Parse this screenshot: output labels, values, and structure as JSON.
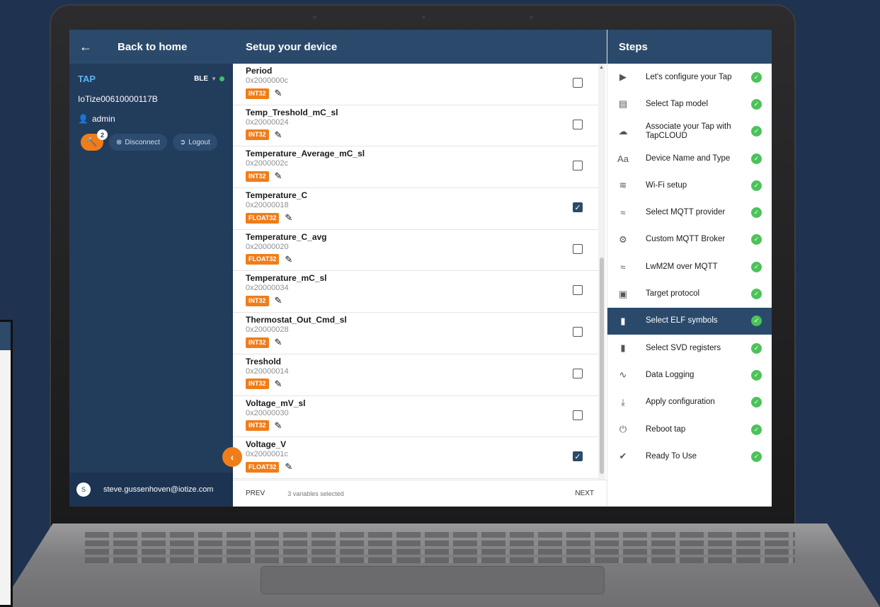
{
  "left": {
    "back_label": "Back to home",
    "tap_name": "TAP",
    "connection": "BLE",
    "device_id": "IoTize00610000117B",
    "user": "admin",
    "tools_badge": "2",
    "disconnect_label": "Disconnect",
    "logout_label": "Logout",
    "avatar_initial": "S",
    "email": "steve.gussenhoven@iotize.com"
  },
  "middle": {
    "title": "Setup your device",
    "prev_label": "PREV",
    "selected_count": "3 variables selected",
    "next_label": "NEXT",
    "variables": [
      {
        "name": "Period",
        "address": "0x2000000c",
        "type": "INT32",
        "checked": false
      },
      {
        "name": "Temp_Treshold_mC_sl",
        "address": "0x20000024",
        "type": "INT32",
        "checked": false
      },
      {
        "name": "Temperature_Average_mC_sl",
        "address": "0x2000002c",
        "type": "INT32",
        "checked": false
      },
      {
        "name": "Temperature_C",
        "address": "0x20000018",
        "type": "FLOAT32",
        "checked": true
      },
      {
        "name": "Temperature_C_avg",
        "address": "0x20000020",
        "type": "FLOAT32",
        "checked": false
      },
      {
        "name": "Temperature_mC_sl",
        "address": "0x20000034",
        "type": "INT32",
        "checked": false
      },
      {
        "name": "Thermostat_Out_Cmd_sl",
        "address": "0x20000028",
        "type": "INT32",
        "checked": false
      },
      {
        "name": "Treshold",
        "address": "0x20000014",
        "type": "INT32",
        "checked": false
      },
      {
        "name": "Voltage_mV_sl",
        "address": "0x20000030",
        "type": "INT32",
        "checked": false
      },
      {
        "name": "Voltage_V",
        "address": "0x2000001c",
        "type": "FLOAT32",
        "checked": true
      }
    ]
  },
  "steps": {
    "title": "Steps",
    "items": [
      {
        "label": "Let's configure your Tap",
        "icon": "play-icon",
        "active": false
      },
      {
        "label": "Select Tap model",
        "icon": "device-icon",
        "active": false
      },
      {
        "label": "Associate your Tap with TapCLOUD",
        "icon": "cloud-icon",
        "active": false
      },
      {
        "label": "Device Name and Type",
        "icon": "text-icon",
        "active": false
      },
      {
        "label": "Wi-Fi setup",
        "icon": "wifi-icon",
        "active": false
      },
      {
        "label": "Select MQTT provider",
        "icon": "mqtt-icon",
        "active": false
      },
      {
        "label": "Custom MQTT Broker",
        "icon": "gear-icon",
        "active": false
      },
      {
        "label": "LwM2M over MQTT",
        "icon": "mqtt-icon",
        "active": false
      },
      {
        "label": "Target protocol",
        "icon": "chip-icon",
        "active": false
      },
      {
        "label": "Select ELF symbols",
        "icon": "file-icon",
        "active": true
      },
      {
        "label": "Select SVD registers",
        "icon": "file-icon",
        "active": false
      },
      {
        "label": "Data Logging",
        "icon": "chart-icon",
        "active": false
      },
      {
        "label": "Apply configuration",
        "icon": "download-icon",
        "active": false
      },
      {
        "label": "Reboot tap",
        "icon": "power-icon",
        "active": false
      },
      {
        "label": "Ready To Use",
        "icon": "check-circle-icon",
        "active": false
      }
    ]
  },
  "colors": {
    "accent": "#f07d1a",
    "header": "#2b4a6b",
    "sidebar": "#223c5c",
    "success": "#4cc25a"
  }
}
